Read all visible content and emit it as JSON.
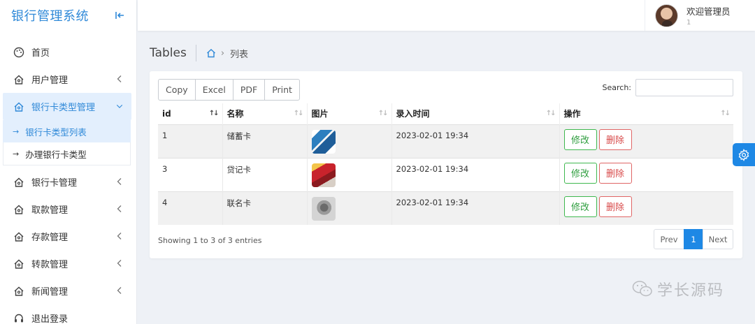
{
  "sidebar": {
    "brand": "银行管理系统",
    "items": [
      {
        "label": "首页"
      },
      {
        "label": "用户管理"
      },
      {
        "label": "银行卡类型管理"
      },
      {
        "label": "银行卡管理"
      },
      {
        "label": "取款管理"
      },
      {
        "label": "存款管理"
      },
      {
        "label": "转款管理"
      },
      {
        "label": "新闻管理"
      },
      {
        "label": "退出登录"
      }
    ],
    "submenu": [
      {
        "label": "银行卡类型列表"
      },
      {
        "label": "办理银行卡类型"
      }
    ]
  },
  "header": {
    "welcome": "欢迎管理员",
    "user_sub": "1"
  },
  "breadcrumb": {
    "title": "Tables",
    "current": "列表"
  },
  "toolbar": {
    "buttons": [
      "Copy",
      "Excel",
      "PDF",
      "Print"
    ]
  },
  "search": {
    "label": "Search:",
    "value": ""
  },
  "table": {
    "columns": [
      "id",
      "名称",
      "图片",
      "录入时间",
      "操作"
    ],
    "rows": [
      {
        "id": "1",
        "name": "储蓄卡",
        "time": "2023-02-01 19:34",
        "edit": "修改",
        "delete": "删除"
      },
      {
        "id": "3",
        "name": "贷记卡",
        "time": "2023-02-01 19:34",
        "edit": "修改",
        "delete": "删除"
      },
      {
        "id": "4",
        "name": "联名卡",
        "time": "2023-02-01 19:34",
        "edit": "修改",
        "delete": "删除"
      }
    ]
  },
  "footer": {
    "info": "Showing 1 to 3 of 3 entries",
    "prev": "Prev",
    "page": "1",
    "next": "Next"
  },
  "watermark": "学长源码",
  "colors": {
    "accent": "#1e88e5",
    "brand": "#2f89d8",
    "edit": "#3fb84f",
    "delete": "#e06565"
  }
}
